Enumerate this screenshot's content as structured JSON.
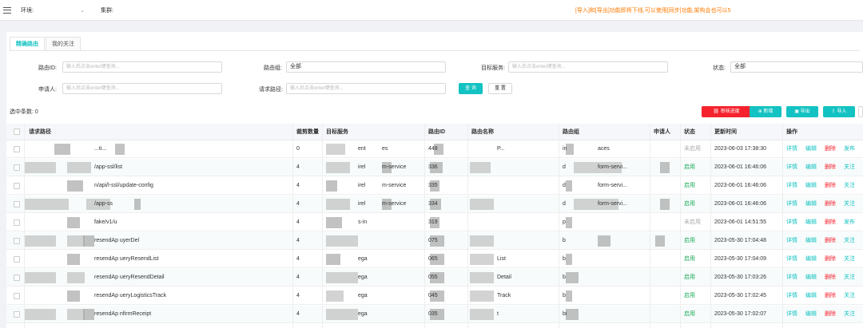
{
  "topbar": {
    "env_label": "环境:",
    "env_chevron": "⌄",
    "cluster_label": "集群:",
    "notice": "[导入]和[导出]功能即将下线,可以使用[同步]功能,架构会也可以5"
  },
  "tabs": [
    {
      "label": "精确路由",
      "active": true
    },
    {
      "label": "我的关注",
      "active": false
    }
  ],
  "filters": {
    "route_id": {
      "label": "路由ID:",
      "placeholder": "输入后点击enter键查询..."
    },
    "route_group": {
      "label": "路由组:",
      "value": "全部"
    },
    "target_service": {
      "label": "目标服务:",
      "placeholder": "输入后点击enter键查询..."
    },
    "status": {
      "label": "状态:",
      "value": "全部"
    },
    "applicant": {
      "label": "申请人:",
      "placeholder": "输入后点击enter键查询..."
    },
    "request_path": {
      "label": "请求路径:",
      "placeholder": "输入后点击enter键查询..."
    },
    "query_label": "查 询",
    "reset_label": "重 置"
  },
  "selected_count": "选中条数: 0",
  "toolbar": {
    "audit_label": "审核进度",
    "add_label": "新增",
    "export_label": "导出",
    "import_label": "导入"
  },
  "table": {
    "headers": [
      "请求路径",
      "裁剪数量",
      "目标服务",
      "路由ID",
      "路由名称",
      "路由组",
      "申请人",
      "状态",
      "更新时间",
      "操作"
    ],
    "rows": [
      {
        "path": "...ti...",
        "count": "0",
        "service": "ent",
        "service2": "es",
        "id": "448",
        "name": "P...",
        "group": "in",
        "group2": "aces",
        "status": "未启用",
        "enabled": false,
        "time": "2023-06-03 17:38:30",
        "actions": [
          "详情",
          "编辑",
          "删除",
          "发布"
        ]
      },
      {
        "path": "/app-ssl/list",
        "count": "4",
        "service": "irel",
        "service2": "m-service",
        "id": "336",
        "name": "",
        "group": "d",
        "group2": "form-servi...",
        "status": "启用",
        "enabled": true,
        "time": "2023-06-01 16:46:06",
        "actions": [
          "详情",
          "编辑",
          "删除",
          "关注"
        ]
      },
      {
        "path": "n/api/l-ssl/update-config",
        "count": "4",
        "service": "irel",
        "service2": "m-service",
        "id": "335",
        "name": "",
        "group": "d",
        "group2": "form-servi...",
        "status": "启用",
        "enabled": true,
        "time": "2023-06-01 16:46:06",
        "actions": [
          "详情",
          "编辑",
          "删除",
          "关注"
        ]
      },
      {
        "path": "/app-ss",
        "count": "4",
        "service": "irel",
        "service2": "m-service",
        "id": "334",
        "name": "",
        "group": "d",
        "group2": "form-servi...",
        "status": "启用",
        "enabled": true,
        "time": "2023-06-01 16:46:06",
        "actions": [
          "详情",
          "编辑",
          "删除",
          "关注"
        ]
      },
      {
        "path": "fake/v1/u",
        "count": "4",
        "service": "s-in",
        "service2": "",
        "id": "319",
        "name": "",
        "group": "p",
        "group2": "",
        "status": "未启用",
        "enabled": false,
        "time": "2023-06-01 14:51:55",
        "actions": [
          "详情",
          "编辑",
          "删除",
          "发布"
        ]
      },
      {
        "path": "resendAp uyerDel",
        "count": "4",
        "service": "",
        "service2": "",
        "id": "075",
        "name": "",
        "group": "b",
        "group2": "",
        "status": "启用",
        "enabled": true,
        "time": "2023-05-30 17:04:48",
        "actions": [
          "详情",
          "编辑",
          "删除",
          "关注"
        ]
      },
      {
        "path": "resendAp ueryResendList",
        "count": "4",
        "service": "ega",
        "service2": "",
        "id": "065",
        "name": "List",
        "group": "b",
        "group2": "",
        "status": "启用",
        "enabled": true,
        "time": "2023-05-30 17:04:09",
        "actions": [
          "详情",
          "编辑",
          "删除",
          "关注"
        ]
      },
      {
        "path": "resendAp ueryResendDetail",
        "count": "4",
        "service": "ega",
        "service2": "",
        "id": "055",
        "name": "Detail",
        "group": "b",
        "group2": "",
        "status": "启用",
        "enabled": true,
        "time": "2023-05-30 17:03:26",
        "actions": [
          "详情",
          "编辑",
          "删除",
          "关注"
        ]
      },
      {
        "path": "resendAp ueryLogisticsTrack",
        "count": "4",
        "service": "ega",
        "service2": "",
        "id": "045",
        "name": "Track",
        "group": "b",
        "group2": "",
        "status": "启用",
        "enabled": true,
        "time": "2023-05-30 17:02:45",
        "actions": [
          "详情",
          "编辑",
          "删除",
          "关注"
        ]
      },
      {
        "path": "resendAp nfirmReceipt",
        "count": "4",
        "service": "ega",
        "service2": "",
        "id": "035",
        "name": "t",
        "group": "bi",
        "group2": "",
        "status": "启用",
        "enabled": true,
        "time": "2023-05-30 17:02:07",
        "actions": [
          "详情",
          "编辑",
          "删除",
          "关注"
        ]
      }
    ]
  },
  "colors": {
    "accent": "#13c2c2",
    "danger": "#f5222d",
    "notice": "#ff7a00",
    "enabled": "#1aaa55"
  }
}
